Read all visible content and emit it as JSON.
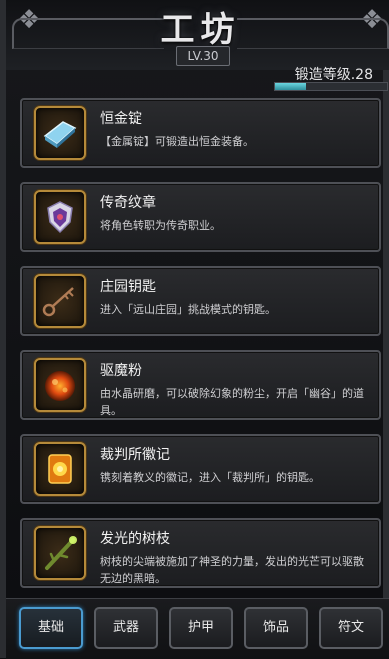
{
  "header": {
    "title": "工坊",
    "level": "LV.30"
  },
  "forge": {
    "level_label": "锻造等级.28",
    "progress": 0.28
  },
  "items": [
    {
      "name": "恒金锭",
      "desc": "【金属锭】可锻造出恒金装备。",
      "icon": "ingot-icon"
    },
    {
      "name": "传奇纹章",
      "desc": "将角色转职为传奇职业。",
      "icon": "crest-icon"
    },
    {
      "name": "庄园钥匙",
      "desc": "进入「远山庄园」挑战模式的钥匙。",
      "icon": "key-icon"
    },
    {
      "name": "驱魔粉",
      "desc": "由水晶研磨，可以破除幻象的粉尘，开启「幽谷」的道具。",
      "icon": "powder-icon"
    },
    {
      "name": "裁判所徽记",
      "desc": "镌刻着教义的徽记，进入「裁判所」的钥匙。",
      "icon": "emblem-icon"
    },
    {
      "name": "发光的树枝",
      "desc": "树枝的尖端被施加了神圣的力量，发出的光芒可以驱散无边的黑暗。",
      "icon": "branch-icon"
    }
  ],
  "tabs": [
    {
      "label": "基础",
      "active": true
    },
    {
      "label": "武器",
      "active": false
    },
    {
      "label": "护甲",
      "active": false
    },
    {
      "label": "饰品",
      "active": false
    },
    {
      "label": "符文",
      "active": false
    }
  ]
}
